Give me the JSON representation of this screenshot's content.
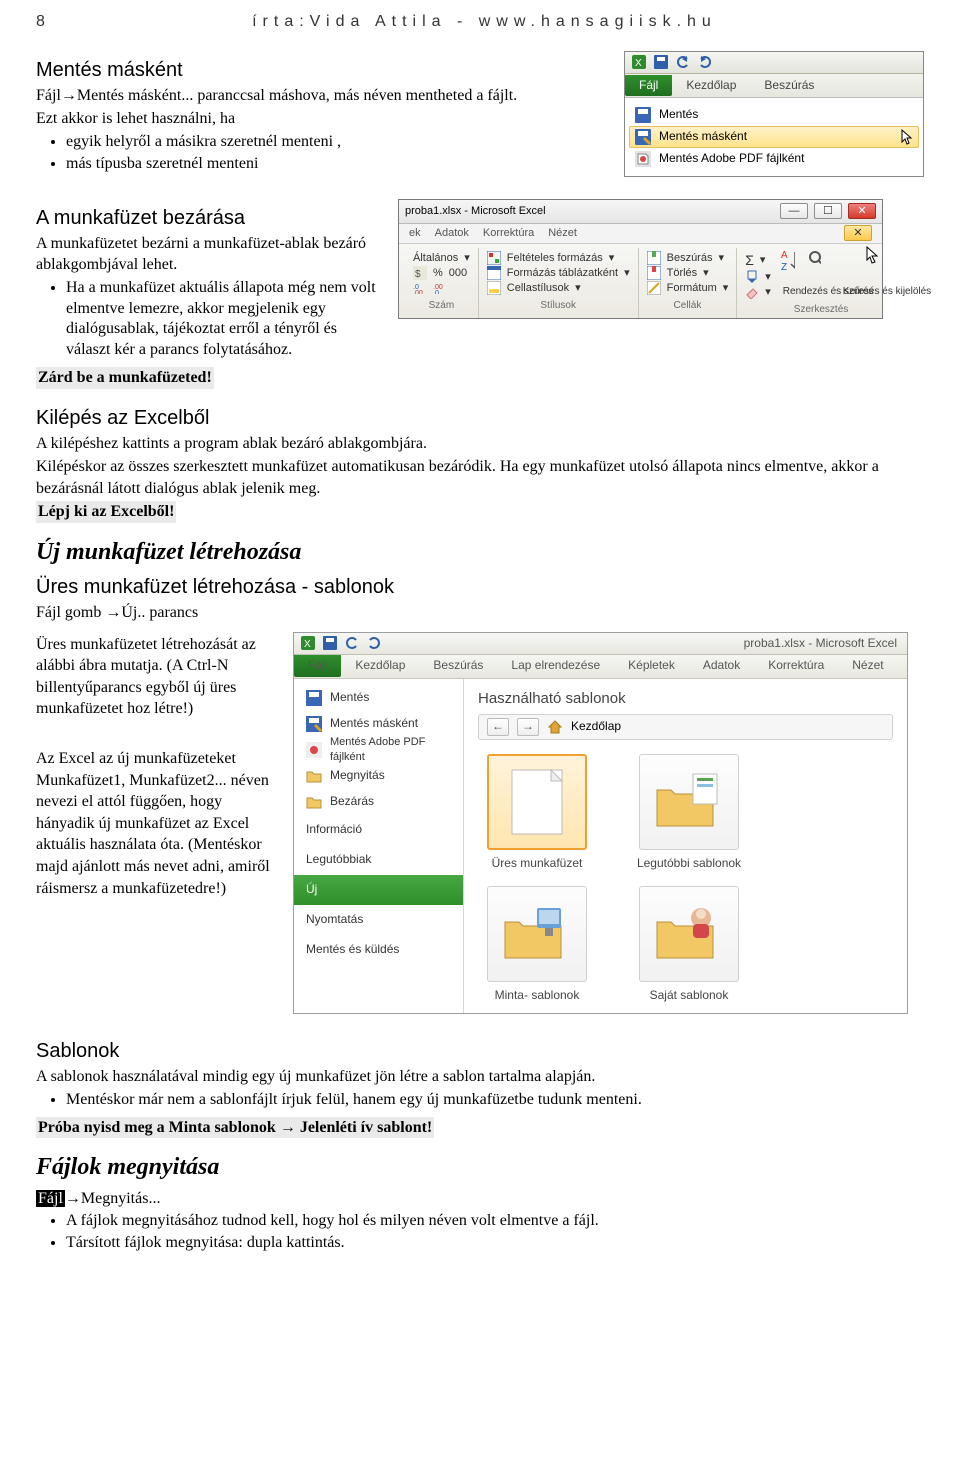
{
  "page_number": "8",
  "header_text": "írta:Vida Attila - www.hansagiisk.hu",
  "sec1": {
    "h": "Mentés másként",
    "p1a": "Fájl",
    "p1b": "Mentés másként... paranccsal máshova, más néven mentheted a fájlt.",
    "p2": "Ezt akkor is lehet használni, ha",
    "b1": "egyik helyről a másikra szeretnél menteni ,",
    "b2": "más típusba szeretnél menteni"
  },
  "sec2": {
    "h": "A munkafüzet bezárása",
    "p1": "A munkafüzetet bezárni a munkafüzet-ablak bezáró ablakgombjával lehet.",
    "b1": "Ha a munkafüzet aktuális állapota még nem volt elmentve lemezre, akkor megjelenik egy dialógusablak, tájékoztat erről a tényről és választ kér a parancs folytatásához.",
    "task": "Zárd be a munkafüzeted!"
  },
  "sec3": {
    "h": "Kilépés az Excelből",
    "p1": "A kilépéshez kattints a program ablak bezáró ablakgombjára.",
    "p2": "Kilépéskor az összes szerkesztett munkafüzet automatikusan bezáródik. Ha egy munkafüzet utolsó állapota nincs elmentve, akkor a bezárásnál látott dialógus ablak jelenik meg.",
    "task": "Lépj ki az Excelből!"
  },
  "sec4": {
    "h": "Új munkafüzet létrehozása",
    "sub": "Üres munkafüzet létrehozása - sablonok",
    "p1a": "Fájl gomb ",
    "p1b": "Új.. parancs",
    "p2": "Üres munkafüzetet létrehozását az alábbi ábra mutatja. (A Ctrl-N billentyűparancs egyből új üres munkafüzetet hoz létre!)",
    "p3": "Az Excel az új munkafüzeteket Munkafüzet1, Munkafüzet2... néven nevezi el attól függően, hogy hányadik új munkafüzet az Excel aktuális használata óta. (Mentéskor majd ajánlott más nevet adni, amiről ráismersz a munkafüzetedre!)"
  },
  "sec5": {
    "h": "Sablonok",
    "p1": "A sablonok használatával mindig egy új munkafüzet jön létre a sablon tartalma alapján.",
    "b1": "Mentéskor már nem a sablonfájlt írjuk felül, hanem egy új munkafüzetbe tudunk menteni.",
    "task": "Próba nyisd meg a Minta sablonok → Jelenléti ív sablont!"
  },
  "sec6": {
    "h": "Fájlok megnyitása",
    "p1a": "Fájl",
    "p1b": "Megnyitás...",
    "b1": "A fájlok megnyitásához tudnod kell, hogy hol és milyen néven volt elmentve a fájl.",
    "b2": "Társított fájlok megnyitása: dupla kattintás."
  },
  "arrow": "→",
  "shot1": {
    "tab_file": "Fájl",
    "tab_home": "Kezdőlap",
    "tab_insert": "Beszúrás",
    "m_save": "Mentés",
    "m_saveas": "Mentés másként",
    "m_savepdf": "Mentés Adobe PDF fájlként"
  },
  "shot2": {
    "title": "proba1.xlsx  -  Microsoft Excel",
    "tabs": {
      "ek": "ek",
      "adatok": "Adatok",
      "korr": "Korrektúra",
      "nezet": "Nézet"
    },
    "g1": {
      "l1": "Általános",
      "l2": "000",
      "cap": "Szám"
    },
    "g2": {
      "l1": "Feltételes formázás",
      "l2": "Formázás táblázatként",
      "l3": "Cellastílusok",
      "cap": "Stílusok"
    },
    "g3": {
      "l1": "Beszúrás",
      "l2": "Törlés",
      "l3": "Formátum",
      "cap": "Cellák"
    },
    "g4": {
      "sort": "Rendezés és szűrés",
      "find": "Keresés és kijelölés",
      "cap": "Szerkesztés"
    },
    "sigma": "Σ"
  },
  "shot3": {
    "title": "proba1.xlsx  -  Microsoft Excel",
    "tabs": {
      "file": "Fájl",
      "home": "Kezdőlap",
      "ins": "Beszúrás",
      "lay": "Lap elrendezése",
      "form": "Képletek",
      "data": "Adatok",
      "rev": "Korrektúra",
      "view": "Nézet"
    },
    "side": {
      "save": "Mentés",
      "saveas": "Mentés másként",
      "pdf": "Mentés Adobe PDF fájlként",
      "open": "Megnyitás",
      "close": "Bezárás",
      "info": "Információ",
      "recent": "Legutóbbiak",
      "new": "Új",
      "print": "Nyomtatás",
      "send": "Mentés és küldés"
    },
    "main_hdr": "Használható sablonok",
    "nav_home": "Kezdőlap",
    "tmpl": {
      "blank": "Üres munkafüzet",
      "recent": "Legutóbbi sablonok",
      "sample": "Minta- sablonok",
      "my": "Saját sablonok"
    }
  }
}
